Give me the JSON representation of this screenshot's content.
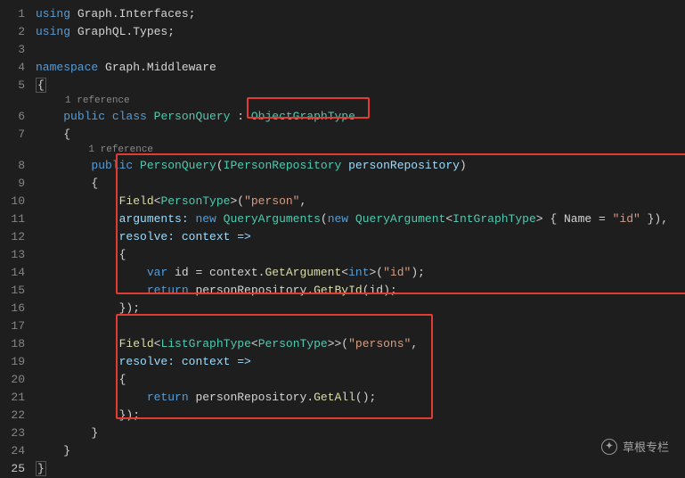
{
  "lines": {
    "l1": "using Graph.Interfaces;",
    "l2": "using GraphQL.Types;",
    "l4_a": "namespace",
    "l4_b": " Graph.Middleware",
    "ref6": "1 reference",
    "l6_a": "public class",
    "l6_b": " PersonQuery",
    "l6_c": " : ",
    "l6_d": "ObjectGraphType",
    "ref8": "1 reference",
    "l8_a": "public",
    "l8_b": " PersonQuery",
    "l8_c": "(",
    "l8_d": "IPersonRepository",
    "l8_e": " personRepository",
    "l8_f": ")",
    "l10_a": "Field",
    "l10_b": "<",
    "l10_c": "PersonType",
    "l10_d": ">(",
    "l10_e": "\"person\"",
    "l10_f": ",",
    "l11_a": "arguments: ",
    "l11_b": "new",
    "l11_c": " QueryArguments",
    "l11_d": "(",
    "l11_e": "new",
    "l11_f": " QueryArgument",
    "l11_g": "<",
    "l11_h": "IntGraphType",
    "l11_i": "> { Name = ",
    "l11_j": "\"id\"",
    "l11_k": " }),",
    "l12_a": "resolve: context =>",
    "l14_a": "var",
    "l14_b": " id = context.",
    "l14_c": "GetArgument",
    "l14_d": "<",
    "l14_e": "int",
    "l14_f": ">(",
    "l14_g": "\"id\"",
    "l14_h": ");",
    "l15_a": "return",
    "l15_b": " personRepository.",
    "l15_c": "GetById",
    "l15_d": "(id);",
    "l16": "});",
    "l18_a": "Field",
    "l18_b": "<",
    "l18_c": "ListGraphType",
    "l18_d": "<",
    "l18_e": "PersonType",
    "l18_f": ">>(",
    "l18_g": "\"persons\"",
    "l18_h": ",",
    "l19_a": "resolve: context =>",
    "l21_a": "return",
    "l21_b": " personRepository.",
    "l21_c": "GetAll",
    "l21_d": "();",
    "l22": "});",
    "brace_open": "{",
    "brace_close": "}",
    "brace_open_hl": "{",
    "brace_close_hl": "}"
  },
  "gutter": [
    "1",
    "2",
    "3",
    "4",
    "5",
    "6",
    "7",
    "8",
    "9",
    "10",
    "11",
    "12",
    "13",
    "14",
    "15",
    "16",
    "17",
    "18",
    "19",
    "20",
    "21",
    "22",
    "23",
    "24",
    "25"
  ],
  "watermark": "草根专栏"
}
